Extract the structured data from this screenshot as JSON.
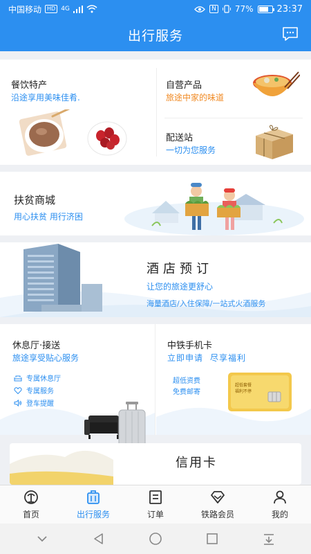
{
  "status": {
    "carrier": "中国移动",
    "hd": "HD",
    "net": "4G",
    "battery_pct": "77%",
    "battery_level": 0.77,
    "time": "23:37",
    "nfc": "N"
  },
  "header": {
    "title": "出行服务"
  },
  "food": {
    "title": "餐饮特产",
    "subtitle": "沿途享用美味佳肴."
  },
  "own_products": {
    "title": "自营产品",
    "subtitle": "旅途中家的味道"
  },
  "delivery": {
    "title": "配送站",
    "subtitle": "一切为您服务"
  },
  "poverty": {
    "title": "扶贫商城",
    "subtitle": "用心扶贫 用行济困"
  },
  "hotel": {
    "title": "酒店预订",
    "subtitle": "让您的旅途更舒心",
    "features": "海量酒店/入住保障/一站式火酒服务"
  },
  "lounge": {
    "title": "休息厅·接送",
    "subtitle": "旅途享受贴心服务",
    "features": [
      "专属休息厅",
      "专属服务",
      "登车提醒"
    ]
  },
  "simcard": {
    "title": "中铁手机卡",
    "subtitle_a": "立即申请",
    "subtitle_b": "尽享福利",
    "lines": [
      "超低资费",
      "免费邮寄"
    ],
    "card_text": [
      "超低套餐",
      "福利不停"
    ]
  },
  "credit": {
    "title": "信用卡"
  },
  "tabs": [
    {
      "label": "首页",
      "icon": "railway-logo-icon"
    },
    {
      "label": "出行服务",
      "icon": "luggage-icon"
    },
    {
      "label": "订单",
      "icon": "order-list-icon"
    },
    {
      "label": "铁路会员",
      "icon": "diamond-icon"
    },
    {
      "label": "我的",
      "icon": "person-icon"
    }
  ],
  "colors": {
    "primary": "#2c8ff0",
    "orange": "#f08a24"
  }
}
